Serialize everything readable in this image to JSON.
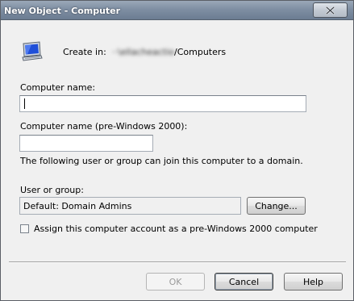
{
  "window": {
    "title": "New Object - Computer"
  },
  "header": {
    "create_in_label": "Create in:",
    "path_prefix_obscured": "··\\ellacheactio",
    "path_suffix": "/Computers"
  },
  "form": {
    "computer_name_label": "Computer name:",
    "computer_name_value": "",
    "pre2000_label": "Computer name (pre-Windows 2000):",
    "pre2000_value": "",
    "join_info": "The following user or group can join this computer to a domain.",
    "user_group_label": "User or group:",
    "user_group_value": "Default: Domain Admins",
    "change_button": "Change...",
    "assign_checkbox_label": "Assign this computer account as a pre-Windows 2000 computer",
    "assign_checked": false
  },
  "footer": {
    "ok": "OK",
    "cancel": "Cancel",
    "help": "Help"
  }
}
